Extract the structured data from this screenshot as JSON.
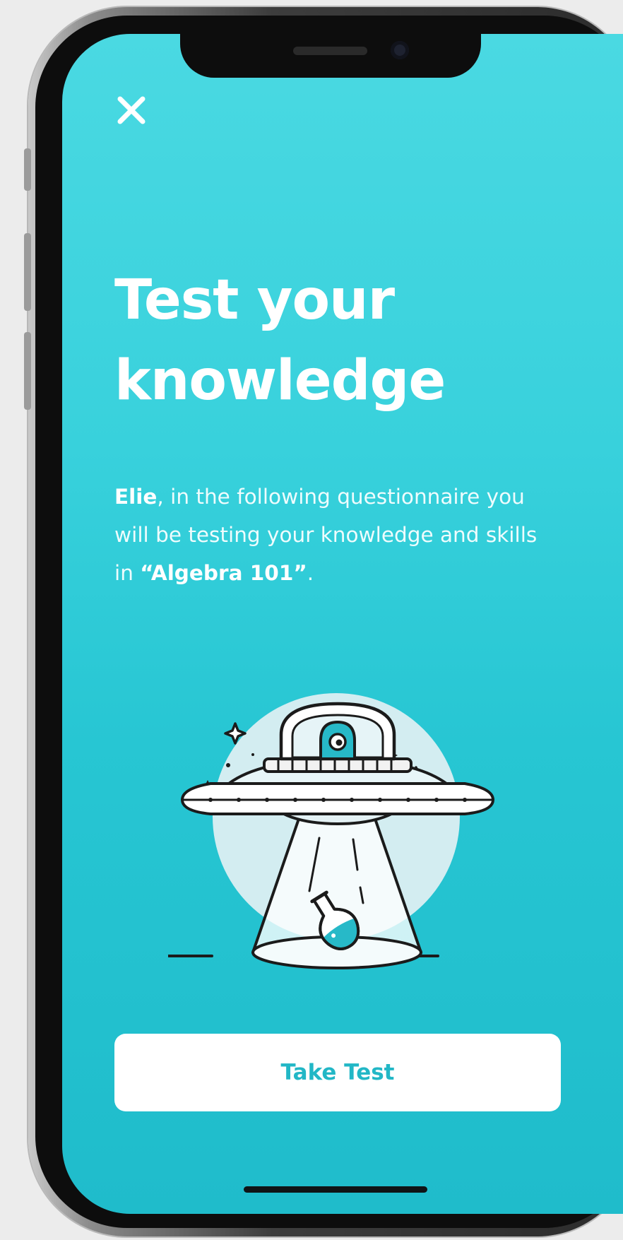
{
  "close_icon": "close-icon",
  "title": {
    "line1": "Test your",
    "line2": "knowledge"
  },
  "description": {
    "name": "Elie",
    "text_1": ", in the following questionnaire you will be testing your knowledge and skills in ",
    "course": "“Algebra 101”",
    "text_2": "."
  },
  "illustration": {
    "icon": "ufo-flask-illustration"
  },
  "cta": {
    "label": "Take Test"
  },
  "colors": {
    "background_top": "#4ad9e2",
    "background_bottom": "#1fbccb",
    "accent": "#22b7c6",
    "button_bg": "#ffffff"
  }
}
